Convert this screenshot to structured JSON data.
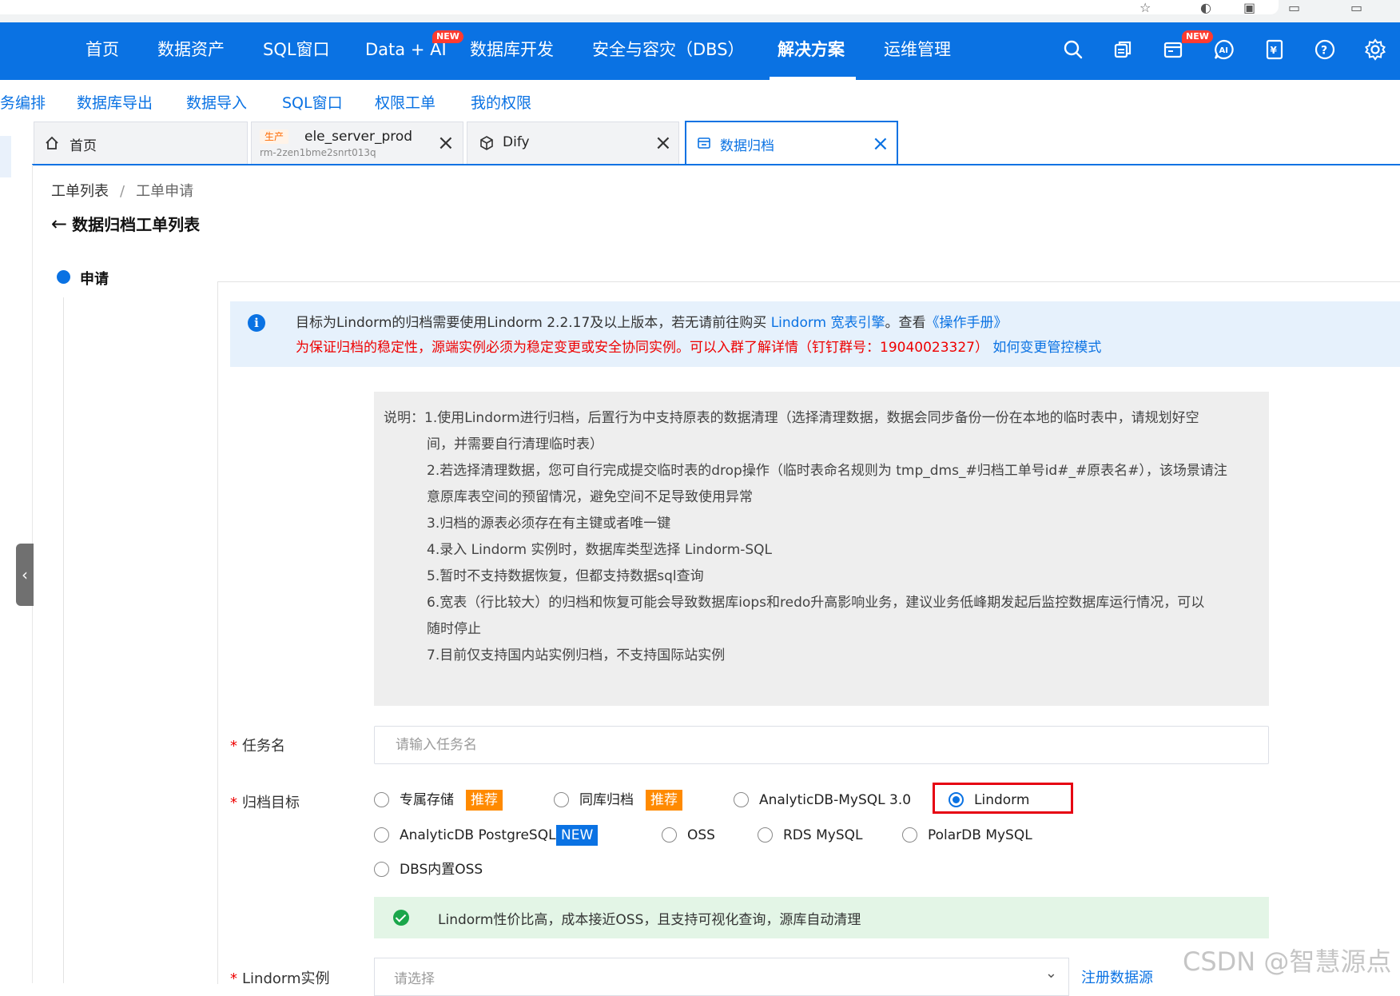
{
  "topnav": {
    "items": [
      "首页",
      "数据资产",
      "SQL窗口",
      "Data + AI",
      "数据库开发",
      "安全与容灾（DBS）",
      "解决方案",
      "运维管理"
    ],
    "active": "解决方案",
    "new_badge": "NEW"
  },
  "subnav": {
    "items": [
      "务编排",
      "数据库导出",
      "数据导入",
      "SQL窗口",
      "权限工单",
      "我的权限"
    ]
  },
  "tabs": [
    {
      "label": "首页"
    },
    {
      "tag": "生产",
      "label": "ele_server_prod",
      "sub": "rm-2zen1bme2snrt013q",
      "close": "×"
    },
    {
      "label": "Dify",
      "close": "×"
    },
    {
      "label": "数据归档",
      "close": "×"
    }
  ],
  "breadcrumb": {
    "parent": "工单列表",
    "sep": "/",
    "current": "工单申请"
  },
  "page_title": "数据归档工单列表",
  "step": {
    "label": "申请"
  },
  "info": {
    "line1_prefix": "目标为Lindorm的归档需要使用Lindorm 2.2.17及以上版本，若无请前往购买 ",
    "line1_link1": "Lindorm 宽表引擎",
    "line1_mid": "。查看",
    "line1_link2": "《操作手册》",
    "line2": "为保证归档的稳定性，源端实例必须为稳定变更或安全协同实例。可以入群了解详情（钉钉群号：19040023327）",
    "line2_link": "如何变更管控模式"
  },
  "notes": [
    "说明：1.使用Lindorm进行归档，后置行为中支持原表的数据清理（选择清理数据，数据会同步备份一份在本地的临时表中，请规划好空",
    "间，并需要自行清理临时表）",
    "2.若选择清理数据，您可自行完成提交临时表的drop操作（临时表命名规则为 tmp_dms_#归档工单号id#_#原表名#），该场景请注",
    "意原库表空间的预留情况，避免空间不足导致使用异常",
    "3.归档的源表必须存在有主键或者唯一键",
    "4.录入 Lindorm 实例时，数据库类型选择 Lindorm-SQL",
    "5.暂时不支持数据恢复，但都支持数据sql查询",
    "6.宽表（行比较大）的归档和恢复可能会导致数据库iops和redo升高影响业务，建议业务低峰期发起后监控数据库运行情况，可以",
    "随时停止",
    "7.目前仅支持国内站实例归档，不支持国际站实例"
  ],
  "form": {
    "required_mark": "*",
    "task_name": {
      "label": "任务名",
      "placeholder": "请输入任务名",
      "value": ""
    },
    "archive_target": {
      "label": "归档目标",
      "options": [
        {
          "label": "专属存储",
          "tag": "推荐"
        },
        {
          "label": "同库归档",
          "tag": "推荐"
        },
        {
          "label": "AnalyticDB-MySQL 3.0"
        },
        {
          "label": "Lindorm",
          "selected": true
        },
        {
          "label": "AnalyticDB PostgreSQL",
          "tag": "NEW"
        },
        {
          "label": "OSS"
        },
        {
          "label": "RDS MySQL"
        },
        {
          "label": "PolarDB MySQL"
        },
        {
          "label": "DBS内置OSS"
        }
      ],
      "selected": "Lindorm",
      "hint": "Lindorm性价比高，成本接近OSS，且支持可视化查询，源库自动清理"
    },
    "lindorm_instance": {
      "label": "Lindorm实例",
      "placeholder": "请选择",
      "register_link": "注册数据源"
    }
  },
  "watermark": "CSDN @智慧源点",
  "colors": {
    "brand": "#0a72e3",
    "danger": "#e00000",
    "recommend": "#ff8a00",
    "success": "#1aa64a"
  }
}
